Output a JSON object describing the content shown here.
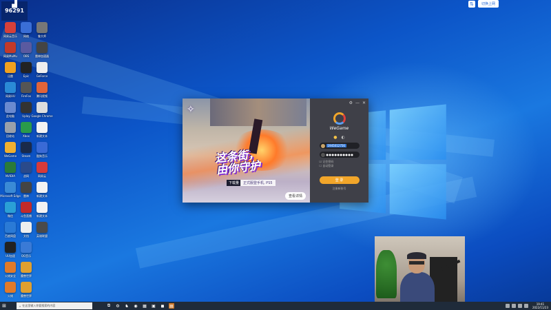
{
  "counter_widget": {
    "number": "96291"
  },
  "desktop_icons": [
    {
      "col": 0,
      "row": 0,
      "icon": "app-icon",
      "color": "#d6403a",
      "label": "网易云音乐"
    },
    {
      "col": 1,
      "row": 0,
      "icon": "app-icon",
      "color": "#3a6ed6",
      "label": "网络"
    },
    {
      "col": 2,
      "row": 0,
      "icon": "app-icon",
      "color": "#777777",
      "label": "鲁大师"
    },
    {
      "col": 0,
      "row": 1,
      "icon": "app-icon",
      "color": "#c23a2a",
      "label": "网易MuMu"
    },
    {
      "col": 1,
      "row": 1,
      "icon": "app-icon",
      "color": "#5a5aa0",
      "label": "OBS"
    },
    {
      "col": 2,
      "row": 1,
      "icon": "app-icon",
      "color": "#444444",
      "label": "雷神加速器"
    },
    {
      "col": 0,
      "row": 2,
      "icon": "app-icon",
      "color": "#f0a020",
      "label": "迅雷"
    },
    {
      "col": 1,
      "row": 2,
      "icon": "app-icon",
      "color": "#222222",
      "label": "Epic"
    },
    {
      "col": 2,
      "row": 2,
      "icon": "app-icon",
      "color": "#eeeeee",
      "label": "GeForce"
    },
    {
      "col": 0,
      "row": 3,
      "icon": "app-icon",
      "color": "#2a8ad6",
      "label": "网易UU"
    },
    {
      "col": 1,
      "row": 3,
      "icon": "app-icon",
      "color": "#555555",
      "label": "FireFox"
    },
    {
      "col": 2,
      "row": 3,
      "icon": "app-icon",
      "color": "#e0643a",
      "label": "腾讯视频"
    },
    {
      "col": 0,
      "row": 4,
      "icon": "app-icon",
      "color": "#6a8ad0",
      "label": "此电脑"
    },
    {
      "col": 1,
      "row": 4,
      "icon": "app-icon",
      "color": "#333333",
      "label": "Uplay"
    },
    {
      "col": 2,
      "row": 4,
      "icon": "app-icon",
      "color": "#dddddd",
      "label": "Google Chrome"
    },
    {
      "col": 0,
      "row": 5,
      "icon": "app-icon",
      "color": "#9aa0aa",
      "label": "回收站"
    },
    {
      "col": 1,
      "row": 5,
      "icon": "app-icon",
      "color": "#2a9a4a",
      "label": "Xbox"
    },
    {
      "col": 2,
      "row": 5,
      "icon": "app-icon",
      "color": "#f2f2f2",
      "label": "新建文本"
    },
    {
      "col": 0,
      "row": 6,
      "icon": "app-icon",
      "color": "#f0b030",
      "label": "WeGame"
    },
    {
      "col": 1,
      "row": 6,
      "icon": "app-icon",
      "color": "#1a2a4a",
      "label": "Steam"
    },
    {
      "col": 2,
      "row": 6,
      "icon": "app-icon",
      "color": "#3a6ad6",
      "label": "酷狗音乐"
    },
    {
      "col": 0,
      "row": 7,
      "icon": "app-icon",
      "color": "#2a7a3a",
      "label": "NVIDIA"
    },
    {
      "col": 1,
      "row": 7,
      "icon": "app-icon",
      "color": "#2a4a8a",
      "label": "战网"
    },
    {
      "col": 2,
      "row": 7,
      "icon": "app-icon",
      "color": "#d63a3a",
      "label": "网易云"
    },
    {
      "col": 0,
      "row": 8,
      "icon": "app-icon",
      "color": "#3a8ad6",
      "label": "Microsoft Edge"
    },
    {
      "col": 1,
      "row": 8,
      "icon": "app-icon",
      "color": "#444444",
      "label": "雷神"
    },
    {
      "col": 2,
      "row": 8,
      "icon": "app-icon",
      "color": "#f2f2f2",
      "label": "新建文本"
    },
    {
      "col": 0,
      "row": 9,
      "icon": "app-icon",
      "color": "#2aa0d6",
      "label": "微信"
    },
    {
      "col": 1,
      "row": 9,
      "icon": "app-icon",
      "color": "#c22a2a",
      "label": "斗鱼直播"
    },
    {
      "col": 2,
      "row": 9,
      "icon": "app-icon",
      "color": "#f2f2f2",
      "label": "新建文本"
    },
    {
      "col": 0,
      "row": 10,
      "icon": "app-icon",
      "color": "#2a7ad6",
      "label": "百度网盘"
    },
    {
      "col": 1,
      "row": 10,
      "icon": "app-icon",
      "color": "#eeeeee",
      "label": "文档"
    },
    {
      "col": 2,
      "row": 10,
      "icon": "app-icon",
      "color": "#4a4a4a",
      "label": "英雄联盟"
    },
    {
      "col": 0,
      "row": 11,
      "icon": "app-icon",
      "color": "#222222",
      "label": "UU加速"
    },
    {
      "col": 1,
      "row": 11,
      "icon": "app-icon",
      "color": "#3a7ad6",
      "label": "QQ音乐"
    },
    {
      "col": 0,
      "row": 12,
      "icon": "app-icon",
      "color": "#e07a2a",
      "label": "火绒安全"
    },
    {
      "col": 1,
      "row": 12,
      "icon": "app-icon",
      "color": "#e0a030",
      "label": "魔兽世界"
    },
    {
      "col": 0,
      "row": 13,
      "icon": "app-icon",
      "color": "#e07a2a",
      "label": "火绒"
    },
    {
      "col": 1,
      "row": 13,
      "icon": "app-icon",
      "color": "#e0a030",
      "label": "魔兽世界"
    }
  ],
  "top_tray": {
    "pill_label": "切换上网"
  },
  "wegame": {
    "slogan_line1": "这条街，",
    "slogan_line2": "由你守护",
    "download_tag": "下载量",
    "platforms": "正式服登手机, PS5",
    "details_button": "查看详情",
    "brand_name": "WeGame",
    "account_value": "1945012756",
    "password_mask": "●●●●●●●●●●",
    "remember_option": "记住密码",
    "auto_login_option": "自动登录",
    "login_button": "登 录",
    "register_link": "注册新账号"
  },
  "taskbar": {
    "search_placeholder": "在这里输入你要搜索的内容",
    "apps": [
      "⧉",
      "⚙",
      "♞",
      "◉",
      "▦",
      "▣",
      "◼",
      "▤"
    ],
    "time": "19:41",
    "date": "2022/11/23"
  },
  "colors": {
    "accent": "#f2a62a",
    "panel_bg": "#3f4048",
    "desktop_blue": "#0c55c8"
  }
}
